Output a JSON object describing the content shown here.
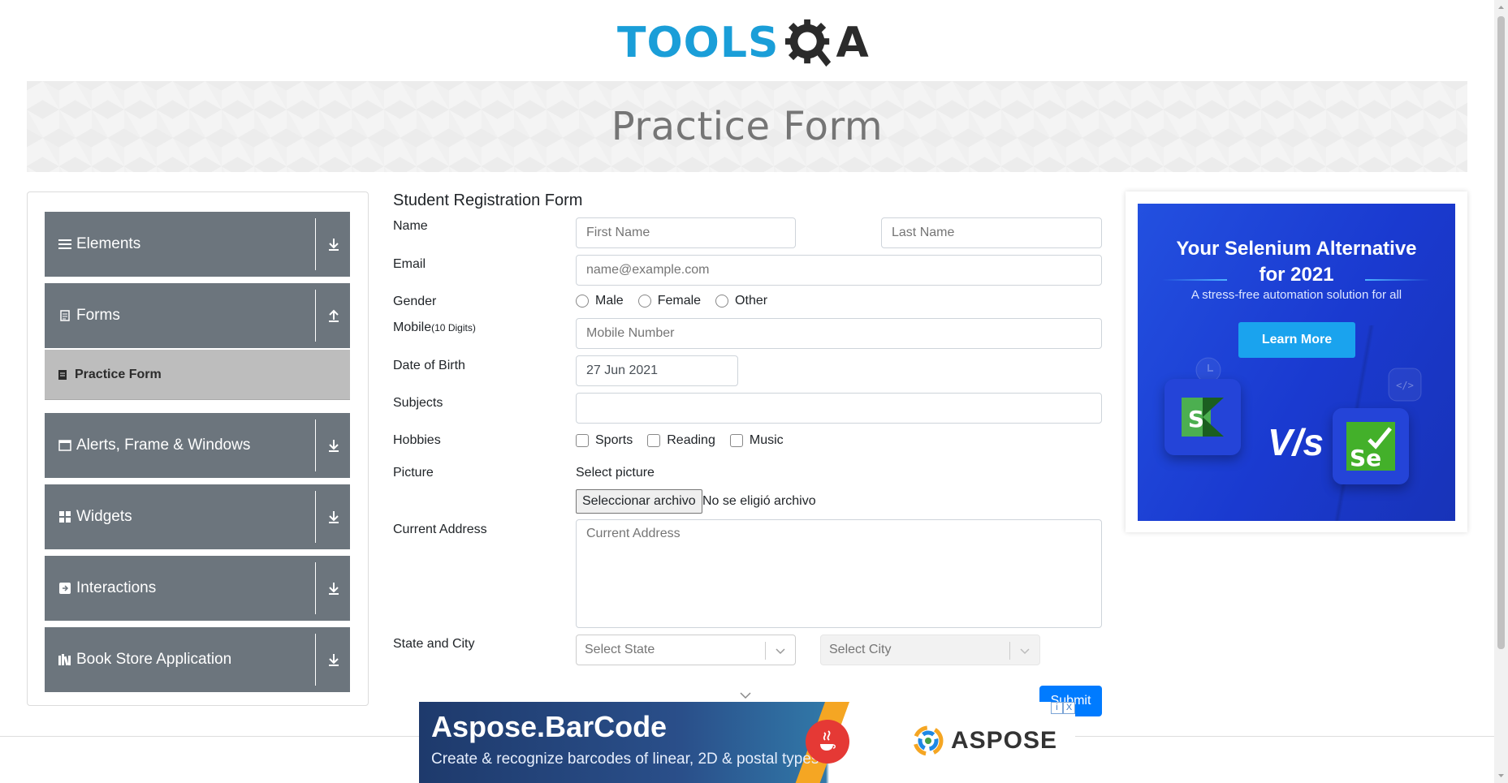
{
  "header": {
    "logo_tools": "TOOLS",
    "logo_a": "A"
  },
  "banner": {
    "title": "Practice Form"
  },
  "sidebar": {
    "groups": [
      {
        "label": "Elements",
        "icon": "menu-icon"
      },
      {
        "label": "Forms",
        "icon": "document-icon"
      },
      {
        "label": "Alerts, Frame & Windows",
        "icon": "window-icon"
      },
      {
        "label": "Widgets",
        "icon": "widgets-icon"
      },
      {
        "label": "Interactions",
        "icon": "interactions-icon"
      },
      {
        "label": "Book Store Application",
        "icon": "library-icon"
      }
    ],
    "sub_item": {
      "label": "Practice Form",
      "icon": "form-icon"
    }
  },
  "form": {
    "title": "Student Registration Form",
    "name_label": "Name",
    "first_name_placeholder": "First Name",
    "last_name_placeholder": "Last Name",
    "email_label": "Email",
    "email_placeholder": "name@example.com",
    "gender_label": "Gender",
    "gender_options": [
      "Male",
      "Female",
      "Other"
    ],
    "mobile_label": "Mobile",
    "mobile_hint": "(10 Digits)",
    "mobile_placeholder": "Mobile Number",
    "dob_label": "Date of Birth",
    "dob_value": "27 Jun 2021",
    "subjects_label": "Subjects",
    "hobbies_label": "Hobbies",
    "hobbies_options": [
      "Sports",
      "Reading",
      "Music"
    ],
    "picture_label": "Picture",
    "picture_hint": "Select picture",
    "file_button": "Seleccionar archivo",
    "file_status": "No se eligió archivo",
    "address_label": "Current Address",
    "address_placeholder": "Current Address",
    "state_city_label": "State and City",
    "state_placeholder": "Select State",
    "city_placeholder": "Select City",
    "submit_label": "Submit"
  },
  "ad_right": {
    "title_line1": "Your Selenium Alternative",
    "title_line2": "for 2021",
    "subtitle": "A stress-free automation solution for all",
    "button": "Learn More",
    "vs": "V/s",
    "tile_left_letter": "S",
    "tile_right_letters": "Se"
  },
  "ad_bottom": {
    "title": "Aspose.BarCode",
    "subtitle": "Create & recognize barcodes of linear, 2D & postal types",
    "brand": "ASPOSE",
    "info_icon": "i",
    "close_icon": "X"
  },
  "colors": {
    "sidebar_group": "#6c757d",
    "sidebar_active": "#bdbdbd",
    "primary": "#007bff",
    "logo_blue": "#1a9ed8"
  }
}
